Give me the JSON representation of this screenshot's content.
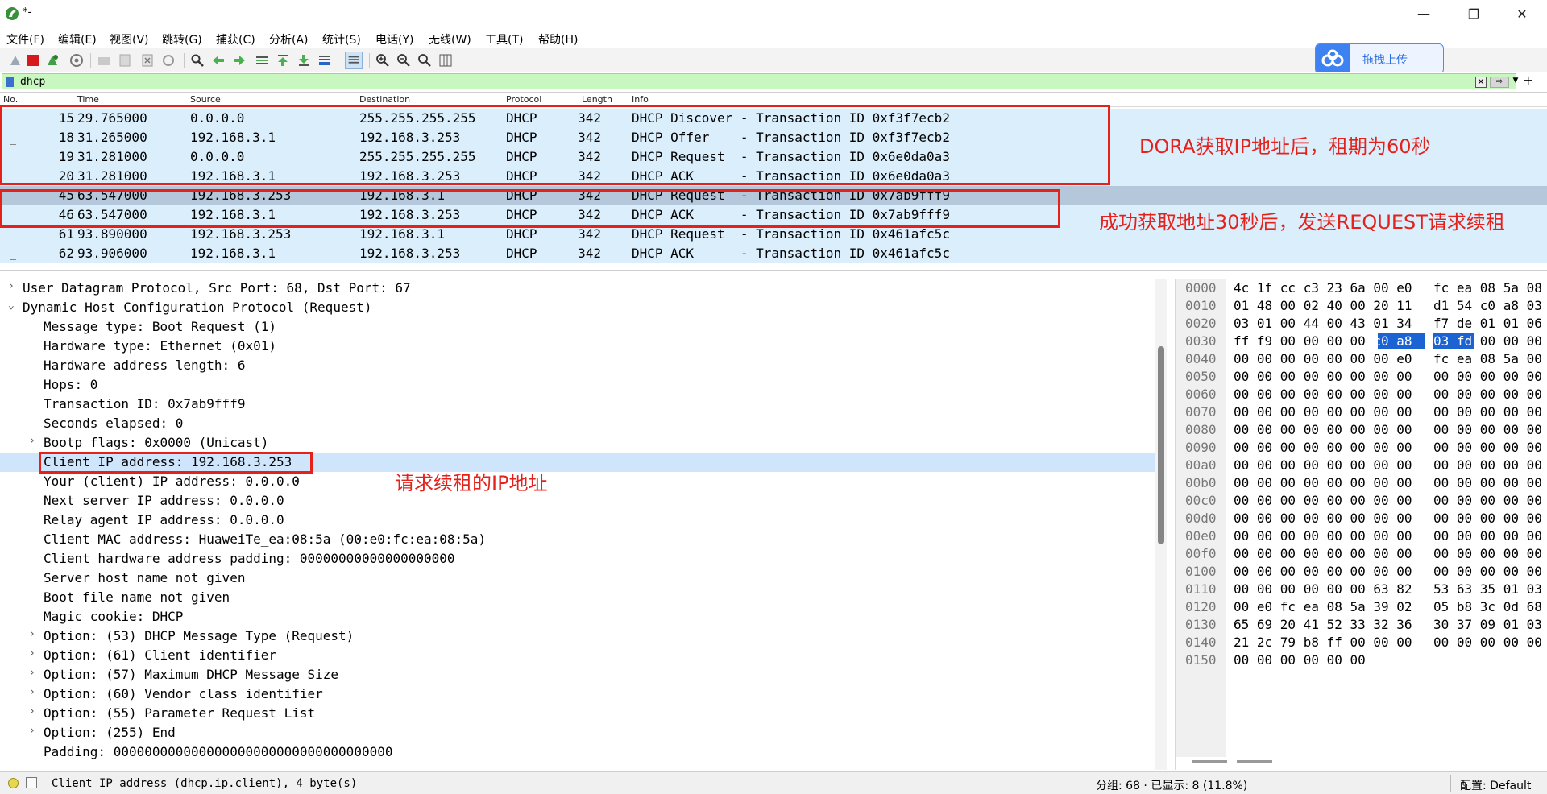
{
  "window": {
    "title": "*-",
    "min_label": "—",
    "restore_label": "❐",
    "close_label": "✕"
  },
  "menu": [
    "文件(F)",
    "编辑(E)",
    "视图(V)",
    "跳转(G)",
    "捕获(C)",
    "分析(A)",
    "统计(S)",
    "电话(Y)",
    "无线(W)",
    "工具(T)",
    "帮助(H)"
  ],
  "upload": {
    "label": "拖拽上传"
  },
  "filter": {
    "value": "dhcp",
    "clear": "✕",
    "apply": "⇨",
    "dropdown": "▼",
    "add": "+"
  },
  "packet_list": {
    "headers": [
      "No.",
      "Time",
      "Source",
      "Destination",
      "Protocol",
      "Length",
      "Info"
    ],
    "rows": [
      {
        "no": "15",
        "time": "29.765000",
        "src": "0.0.0.0",
        "dst": "255.255.255.255",
        "proto": "DHCP",
        "len": "342",
        "info": "DHCP Discover - Transaction ID 0xf3f7ecb2"
      },
      {
        "no": "18",
        "time": "31.265000",
        "src": "192.168.3.1",
        "dst": "192.168.3.253",
        "proto": "DHCP",
        "len": "342",
        "info": "DHCP Offer    - Transaction ID 0xf3f7ecb2"
      },
      {
        "no": "19",
        "time": "31.281000",
        "src": "0.0.0.0",
        "dst": "255.255.255.255",
        "proto": "DHCP",
        "len": "342",
        "info": "DHCP Request  - Transaction ID 0x6e0da0a3"
      },
      {
        "no": "20",
        "time": "31.281000",
        "src": "192.168.3.1",
        "dst": "192.168.3.253",
        "proto": "DHCP",
        "len": "342",
        "info": "DHCP ACK      - Transaction ID 0x6e0da0a3"
      },
      {
        "no": "45",
        "time": "63.547000",
        "src": "192.168.3.253",
        "dst": "192.168.3.1",
        "proto": "DHCP",
        "len": "342",
        "info": "DHCP Request  - Transaction ID 0x7ab9fff9"
      },
      {
        "no": "46",
        "time": "63.547000",
        "src": "192.168.3.1",
        "dst": "192.168.3.253",
        "proto": "DHCP",
        "len": "342",
        "info": "DHCP ACK      - Transaction ID 0x7ab9fff9"
      },
      {
        "no": "61",
        "time": "93.890000",
        "src": "192.168.3.253",
        "dst": "192.168.3.1",
        "proto": "DHCP",
        "len": "342",
        "info": "DHCP Request  - Transaction ID 0x461afc5c"
      },
      {
        "no": "62",
        "time": "93.906000",
        "src": "192.168.3.1",
        "dst": "192.168.3.253",
        "proto": "DHCP",
        "len": "342",
        "info": "DHCP ACK      - Transaction ID 0x461afc5c"
      }
    ]
  },
  "annotations": {
    "dora": "DORA获取IP地址后，租期为60秒",
    "renew": "成功获取地址30秒后，发送REQUEST请求续租",
    "client_ip": "请求续租的IP地址"
  },
  "details": [
    {
      "text": "User Datagram Protocol, Src Port: 68, Dst Port: 67",
      "arrow": "›"
    },
    {
      "text": "Dynamic Host Configuration Protocol (Request)",
      "arrow": "⌄"
    },
    {
      "text": "Message type: Boot Request (1)",
      "arrow": ""
    },
    {
      "text": "Hardware type: Ethernet (0x01)",
      "arrow": ""
    },
    {
      "text": "Hardware address length: 6",
      "arrow": ""
    },
    {
      "text": "Hops: 0",
      "arrow": ""
    },
    {
      "text": "Transaction ID: 0x7ab9fff9",
      "arrow": ""
    },
    {
      "text": "Seconds elapsed: 0",
      "arrow": ""
    },
    {
      "text": "Bootp flags: 0x0000 (Unicast)",
      "arrow": "›"
    },
    {
      "text": "Client IP address: 192.168.3.253",
      "arrow": ""
    },
    {
      "text": "Your (client) IP address: 0.0.0.0",
      "arrow": ""
    },
    {
      "text": "Next server IP address: 0.0.0.0",
      "arrow": ""
    },
    {
      "text": "Relay agent IP address: 0.0.0.0",
      "arrow": ""
    },
    {
      "text": "Client MAC address: HuaweiTe_ea:08:5a (00:e0:fc:ea:08:5a)",
      "arrow": ""
    },
    {
      "text": "Client hardware address padding: 00000000000000000000",
      "arrow": ""
    },
    {
      "text": "Server host name not given",
      "arrow": ""
    },
    {
      "text": "Boot file name not given",
      "arrow": ""
    },
    {
      "text": "Magic cookie: DHCP",
      "arrow": ""
    },
    {
      "text": "Option: (53) DHCP Message Type (Request)",
      "arrow": "›"
    },
    {
      "text": "Option: (61) Client identifier",
      "arrow": "›"
    },
    {
      "text": "Option: (57) Maximum DHCP Message Size",
      "arrow": "›"
    },
    {
      "text": "Option: (60) Vendor class identifier",
      "arrow": "›"
    },
    {
      "text": "Option: (55) Parameter Request List",
      "arrow": "›"
    },
    {
      "text": "Option: (255) End",
      "arrow": "›"
    },
    {
      "text": "Padding: 000000000000000000000000000000000000",
      "arrow": ""
    }
  ],
  "bytes": [
    {
      "off": "0000",
      "a": "4c 1f cc c3 23 6a 00 e0",
      "b": "fc ea 08 5a 08"
    },
    {
      "off": "0010",
      "a": "01 48 00 02 40 00 20 11",
      "b": "d1 54 c0 a8 03"
    },
    {
      "off": "0020",
      "a": "03 01 00 44 00 43 01 34",
      "b": "f7 de 01 01 06"
    },
    {
      "off": "0030",
      "a": "ff f9 00 00 00 00 c0 a8",
      "b": "03 fd 00 00 00"
    },
    {
      "off": "0040",
      "a": "00 00 00 00 00 00 00 e0",
      "b": "fc ea 08 5a 00"
    },
    {
      "off": "0050",
      "a": "00 00 00 00 00 00 00 00",
      "b": "00 00 00 00 00"
    },
    {
      "off": "0060",
      "a": "00 00 00 00 00 00 00 00",
      "b": "00 00 00 00 00"
    },
    {
      "off": "0070",
      "a": "00 00 00 00 00 00 00 00",
      "b": "00 00 00 00 00"
    },
    {
      "off": "0080",
      "a": "00 00 00 00 00 00 00 00",
      "b": "00 00 00 00 00"
    },
    {
      "off": "0090",
      "a": "00 00 00 00 00 00 00 00",
      "b": "00 00 00 00 00"
    },
    {
      "off": "00a0",
      "a": "00 00 00 00 00 00 00 00",
      "b": "00 00 00 00 00"
    },
    {
      "off": "00b0",
      "a": "00 00 00 00 00 00 00 00",
      "b": "00 00 00 00 00"
    },
    {
      "off": "00c0",
      "a": "00 00 00 00 00 00 00 00",
      "b": "00 00 00 00 00"
    },
    {
      "off": "00d0",
      "a": "00 00 00 00 00 00 00 00",
      "b": "00 00 00 00 00"
    },
    {
      "off": "00e0",
      "a": "00 00 00 00 00 00 00 00",
      "b": "00 00 00 00 00"
    },
    {
      "off": "00f0",
      "a": "00 00 00 00 00 00 00 00",
      "b": "00 00 00 00 00"
    },
    {
      "off": "0100",
      "a": "00 00 00 00 00 00 00 00",
      "b": "00 00 00 00 00"
    },
    {
      "off": "0110",
      "a": "00 00 00 00 00 00 63 82",
      "b": "53 63 35 01 03"
    },
    {
      "off": "0120",
      "a": "00 e0 fc ea 08 5a 39 02",
      "b": "05 b8 3c 0d 68"
    },
    {
      "off": "0130",
      "a": "65 69 20 41 52 33 32 36",
      "b": "30 37 09 01 03"
    },
    {
      "off": "0140",
      "a": "21 2c 79 b8 ff 00 00 00",
      "b": "00 00 00 00 00"
    },
    {
      "off": "0150",
      "a": "00 00 00 00 00 00",
      "b": ""
    }
  ],
  "status": {
    "field": "Client IP address (dhcp.ip.client), 4 byte(s)",
    "packets": "分组: 68 · 已显示: 8 (11.8%)",
    "profile": "配置: Default"
  },
  "colors": {
    "row_bg": "#dbeefc",
    "row_selected": "#b5c7da",
    "annotation": "#e5211c",
    "filter_ok": "#c8f7c0",
    "hex_selected": "#1b62d3"
  }
}
